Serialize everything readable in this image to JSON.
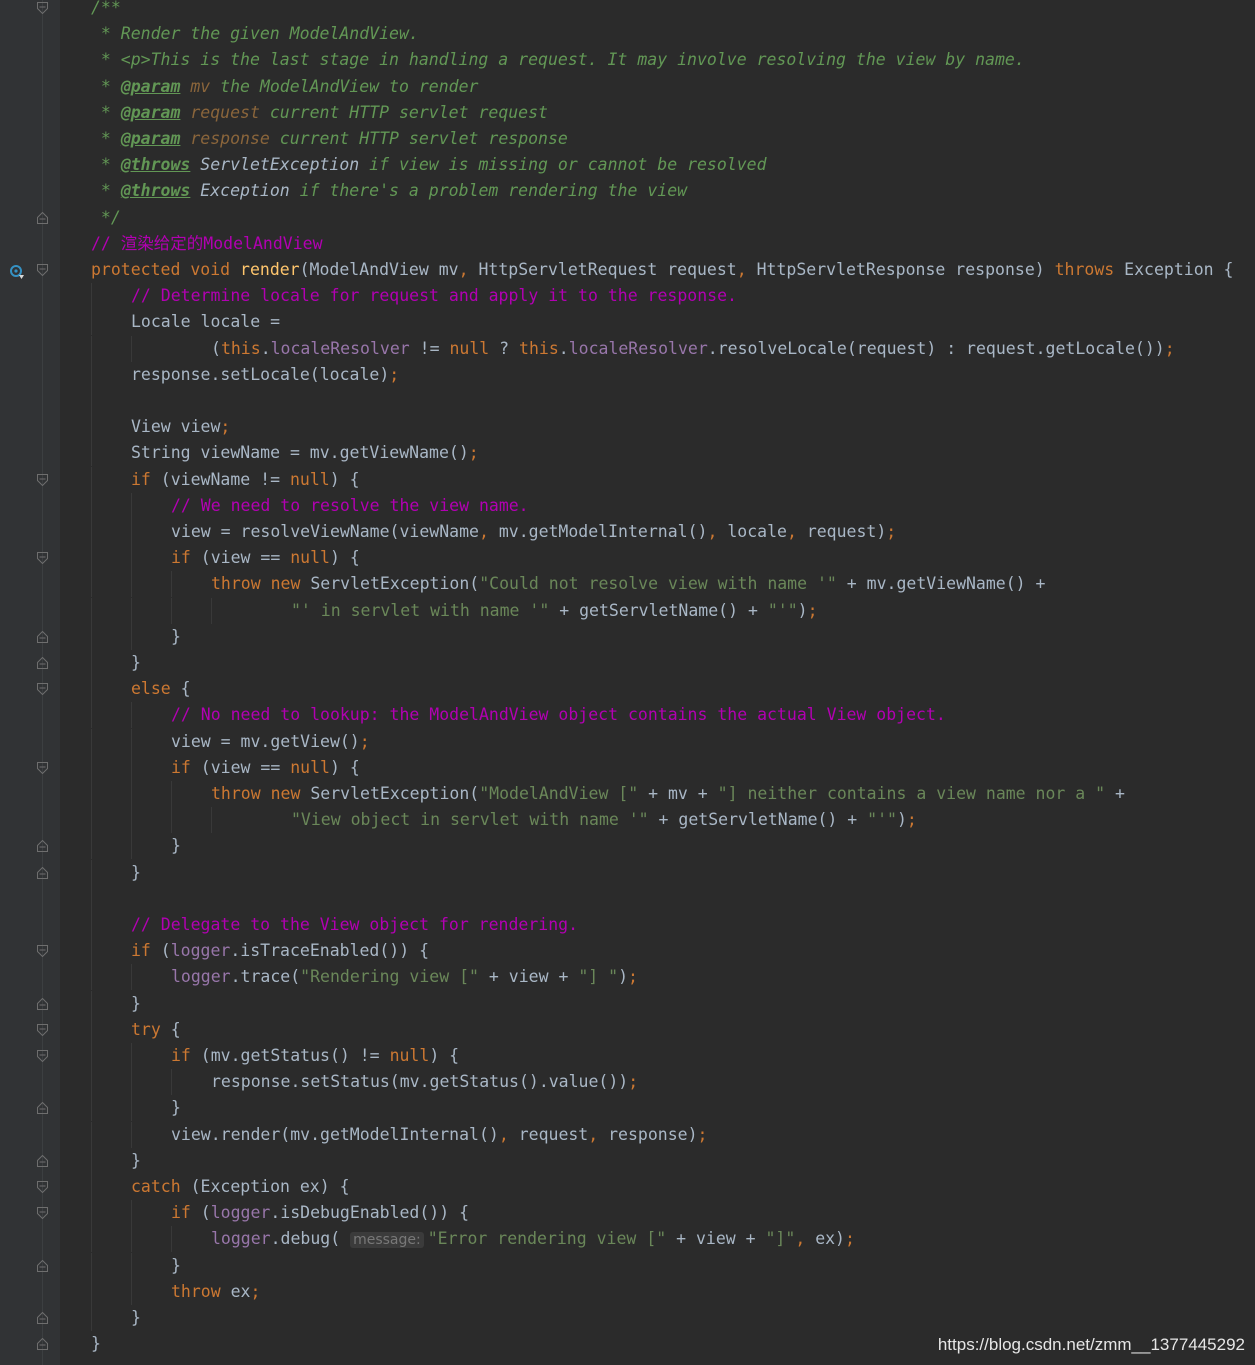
{
  "editor": {
    "language": "java",
    "theme": "Darcula",
    "colors": {
      "background": "#2b2b2b",
      "gutter": "#313335",
      "keyword": "#cc7832",
      "string": "#6a8759",
      "comment": "#b200b2",
      "javadoc": "#629755",
      "method_decl": "#ffc66d",
      "field": "#9876aa",
      "text": "#a9b7c6"
    },
    "gutter_icons": {
      "override": "implementing-method-icon",
      "fold": "fold-marker-icon"
    },
    "lines": [
      {
        "indent": 0,
        "fold": "open",
        "tokens": [
          {
            "c": "doc",
            "t": "/**"
          }
        ]
      },
      {
        "indent": 0,
        "tokens": [
          {
            "c": "doc",
            "t": " * Render the given ModelAndView."
          }
        ]
      },
      {
        "indent": 0,
        "tokens": [
          {
            "c": "doc",
            "t": " * <p>This is the last stage in handling a request. It may involve resolving the view by name."
          }
        ]
      },
      {
        "indent": 0,
        "tokens": [
          {
            "c": "doc",
            "t": " * "
          },
          {
            "c": "tag",
            "t": "@param"
          },
          {
            "c": "doc",
            "t": " "
          },
          {
            "c": "dparam",
            "t": "mv"
          },
          {
            "c": "doc",
            "t": " the ModelAndView to render"
          }
        ]
      },
      {
        "indent": 0,
        "tokens": [
          {
            "c": "doc",
            "t": " * "
          },
          {
            "c": "tag",
            "t": "@param"
          },
          {
            "c": "doc",
            "t": " "
          },
          {
            "c": "dparam",
            "t": "request"
          },
          {
            "c": "doc",
            "t": " current HTTP servlet request"
          }
        ]
      },
      {
        "indent": 0,
        "tokens": [
          {
            "c": "doc",
            "t": " * "
          },
          {
            "c": "tag",
            "t": "@param"
          },
          {
            "c": "doc",
            "t": " "
          },
          {
            "c": "dparam",
            "t": "response"
          },
          {
            "c": "doc",
            "t": " current HTTP servlet response"
          }
        ]
      },
      {
        "indent": 0,
        "tokens": [
          {
            "c": "doc",
            "t": " * "
          },
          {
            "c": "tag",
            "t": "@throws"
          },
          {
            "c": "doc",
            "t": " "
          },
          {
            "c": "dref",
            "t": "ServletException"
          },
          {
            "c": "doc",
            "t": " if view is missing or cannot be resolved"
          }
        ]
      },
      {
        "indent": 0,
        "tokens": [
          {
            "c": "doc",
            "t": " * "
          },
          {
            "c": "tag",
            "t": "@throws"
          },
          {
            "c": "doc",
            "t": " "
          },
          {
            "c": "dref",
            "t": "Exception"
          },
          {
            "c": "doc",
            "t": " if there's a problem rendering the view"
          }
        ]
      },
      {
        "indent": 0,
        "fold": "close",
        "tokens": [
          {
            "c": "doc",
            "t": " */"
          }
        ]
      },
      {
        "indent": 0,
        "tokens": [
          {
            "c": "cmt",
            "t": "// 渲染给定的ModelAndView"
          }
        ]
      },
      {
        "indent": 0,
        "fold": "open",
        "override": true,
        "tokens": [
          {
            "c": "kw",
            "t": "protected void "
          },
          {
            "c": "fn",
            "t": "render"
          },
          {
            "c": "txt",
            "t": "(ModelAndView mv"
          },
          {
            "c": "semi",
            "t": ", "
          },
          {
            "c": "txt",
            "t": "HttpServletRequest request"
          },
          {
            "c": "semi",
            "t": ", "
          },
          {
            "c": "txt",
            "t": "HttpServletResponse response) "
          },
          {
            "c": "kw",
            "t": "throws "
          },
          {
            "c": "txt",
            "t": "Exception {"
          }
        ]
      },
      {
        "indent": 1,
        "tokens": [
          {
            "c": "cmt",
            "t": "// Determine locale for request and apply it to the response."
          }
        ]
      },
      {
        "indent": 1,
        "tokens": [
          {
            "c": "txt",
            "t": "Locale locale ="
          }
        ]
      },
      {
        "indent": 3,
        "guides": 2,
        "tokens": [
          {
            "c": "txt",
            "t": "("
          },
          {
            "c": "kw",
            "t": "this"
          },
          {
            "c": "txt",
            "t": "."
          },
          {
            "c": "fld",
            "t": "localeResolver"
          },
          {
            "c": "txt",
            "t": " != "
          },
          {
            "c": "kw",
            "t": "null"
          },
          {
            "c": "txt",
            "t": " ? "
          },
          {
            "c": "kw",
            "t": "this"
          },
          {
            "c": "txt",
            "t": "."
          },
          {
            "c": "fld",
            "t": "localeResolver"
          },
          {
            "c": "txt",
            "t": ".resolveLocale(request) : request.getLocale())"
          },
          {
            "c": "semi",
            "t": ";"
          }
        ]
      },
      {
        "indent": 1,
        "tokens": [
          {
            "c": "txt",
            "t": "response.setLocale(locale)"
          },
          {
            "c": "semi",
            "t": ";"
          }
        ]
      },
      {
        "indent": 1,
        "tokens": []
      },
      {
        "indent": 1,
        "tokens": [
          {
            "c": "txt",
            "t": "View view"
          },
          {
            "c": "semi",
            "t": ";"
          }
        ]
      },
      {
        "indent": 1,
        "tokens": [
          {
            "c": "txt",
            "t": "String viewName = mv.getViewName()"
          },
          {
            "c": "semi",
            "t": ";"
          }
        ]
      },
      {
        "indent": 1,
        "fold": "open",
        "tokens": [
          {
            "c": "kw",
            "t": "if"
          },
          {
            "c": "txt",
            "t": " (viewName != "
          },
          {
            "c": "kw",
            "t": "null"
          },
          {
            "c": "txt",
            "t": ") {"
          }
        ]
      },
      {
        "indent": 2,
        "tokens": [
          {
            "c": "cmt",
            "t": "// We need to resolve the view name."
          }
        ]
      },
      {
        "indent": 2,
        "tokens": [
          {
            "c": "txt",
            "t": "view = resolveViewName(viewName"
          },
          {
            "c": "semi",
            "t": ", "
          },
          {
            "c": "txt",
            "t": "mv.getModelInternal()"
          },
          {
            "c": "semi",
            "t": ", "
          },
          {
            "c": "txt",
            "t": "locale"
          },
          {
            "c": "semi",
            "t": ", "
          },
          {
            "c": "txt",
            "t": "request)"
          },
          {
            "c": "semi",
            "t": ";"
          }
        ]
      },
      {
        "indent": 2,
        "fold": "open",
        "tokens": [
          {
            "c": "kw",
            "t": "if"
          },
          {
            "c": "txt",
            "t": " (view == "
          },
          {
            "c": "kw",
            "t": "null"
          },
          {
            "c": "txt",
            "t": ") {"
          }
        ]
      },
      {
        "indent": 3,
        "tokens": [
          {
            "c": "kw",
            "t": "throw new "
          },
          {
            "c": "txt",
            "t": "ServletException("
          },
          {
            "c": "str",
            "t": "\"Could not resolve view with name '\""
          },
          {
            "c": "txt",
            "t": " + mv.getViewName() +"
          }
        ]
      },
      {
        "indent": 5,
        "guides": 4,
        "tokens": [
          {
            "c": "str",
            "t": "\"' in servlet with name '\""
          },
          {
            "c": "txt",
            "t": " + getServletName() + "
          },
          {
            "c": "str",
            "t": "\"'\""
          },
          {
            "c": "txt",
            "t": ")"
          },
          {
            "c": "semi",
            "t": ";"
          }
        ]
      },
      {
        "indent": 2,
        "fold": "close",
        "tokens": [
          {
            "c": "txt",
            "t": "}"
          }
        ]
      },
      {
        "indent": 1,
        "fold": "close",
        "tokens": [
          {
            "c": "txt",
            "t": "}"
          }
        ]
      },
      {
        "indent": 1,
        "fold": "open",
        "tokens": [
          {
            "c": "kw",
            "t": "else"
          },
          {
            "c": "txt",
            "t": " {"
          }
        ]
      },
      {
        "indent": 2,
        "tokens": [
          {
            "c": "cmt",
            "t": "// No need to lookup: the ModelAndView object contains the actual View object."
          }
        ]
      },
      {
        "indent": 2,
        "tokens": [
          {
            "c": "txt",
            "t": "view = mv.getView()"
          },
          {
            "c": "semi",
            "t": ";"
          }
        ]
      },
      {
        "indent": 2,
        "fold": "open",
        "tokens": [
          {
            "c": "kw",
            "t": "if"
          },
          {
            "c": "txt",
            "t": " (view == "
          },
          {
            "c": "kw",
            "t": "null"
          },
          {
            "c": "txt",
            "t": ") {"
          }
        ]
      },
      {
        "indent": 3,
        "tokens": [
          {
            "c": "kw",
            "t": "throw new "
          },
          {
            "c": "txt",
            "t": "ServletException("
          },
          {
            "c": "str",
            "t": "\"ModelAndView [\""
          },
          {
            "c": "txt",
            "t": " + mv + "
          },
          {
            "c": "str",
            "t": "\"] neither contains a view name nor a \""
          },
          {
            "c": "txt",
            "t": " +"
          }
        ]
      },
      {
        "indent": 5,
        "guides": 4,
        "tokens": [
          {
            "c": "str",
            "t": "\"View object in servlet with name '\""
          },
          {
            "c": "txt",
            "t": " + getServletName() + "
          },
          {
            "c": "str",
            "t": "\"'\""
          },
          {
            "c": "txt",
            "t": ")"
          },
          {
            "c": "semi",
            "t": ";"
          }
        ]
      },
      {
        "indent": 2,
        "fold": "close",
        "tokens": [
          {
            "c": "txt",
            "t": "}"
          }
        ]
      },
      {
        "indent": 1,
        "fold": "close",
        "tokens": [
          {
            "c": "txt",
            "t": "}"
          }
        ]
      },
      {
        "indent": 1,
        "tokens": []
      },
      {
        "indent": 1,
        "tokens": [
          {
            "c": "cmt",
            "t": "// Delegate to the View object for rendering."
          }
        ]
      },
      {
        "indent": 1,
        "fold": "open",
        "tokens": [
          {
            "c": "kw",
            "t": "if"
          },
          {
            "c": "txt",
            "t": " ("
          },
          {
            "c": "fld",
            "t": "logger"
          },
          {
            "c": "txt",
            "t": ".isTraceEnabled()) {"
          }
        ]
      },
      {
        "indent": 2,
        "tokens": [
          {
            "c": "fld",
            "t": "logger"
          },
          {
            "c": "txt",
            "t": ".trace("
          },
          {
            "c": "str",
            "t": "\"Rendering view [\""
          },
          {
            "c": "txt",
            "t": " + view + "
          },
          {
            "c": "str",
            "t": "\"] \""
          },
          {
            "c": "txt",
            "t": ")"
          },
          {
            "c": "semi",
            "t": ";"
          }
        ]
      },
      {
        "indent": 1,
        "fold": "close",
        "tokens": [
          {
            "c": "txt",
            "t": "}"
          }
        ]
      },
      {
        "indent": 1,
        "fold": "open",
        "tokens": [
          {
            "c": "kw",
            "t": "try"
          },
          {
            "c": "txt",
            "t": " {"
          }
        ]
      },
      {
        "indent": 2,
        "fold": "open",
        "tokens": [
          {
            "c": "kw",
            "t": "if"
          },
          {
            "c": "txt",
            "t": " (mv.getStatus() != "
          },
          {
            "c": "kw",
            "t": "null"
          },
          {
            "c": "txt",
            "t": ") {"
          }
        ]
      },
      {
        "indent": 3,
        "tokens": [
          {
            "c": "txt",
            "t": "response.setStatus(mv.getStatus().value())"
          },
          {
            "c": "semi",
            "t": ";"
          }
        ]
      },
      {
        "indent": 2,
        "fold": "close",
        "tokens": [
          {
            "c": "txt",
            "t": "}"
          }
        ]
      },
      {
        "indent": 2,
        "tokens": [
          {
            "c": "txt",
            "t": "view.render(mv.getModelInternal()"
          },
          {
            "c": "semi",
            "t": ", "
          },
          {
            "c": "txt",
            "t": "request"
          },
          {
            "c": "semi",
            "t": ", "
          },
          {
            "c": "txt",
            "t": "response)"
          },
          {
            "c": "semi",
            "t": ";"
          }
        ]
      },
      {
        "indent": 1,
        "fold": "close",
        "tokens": [
          {
            "c": "txt",
            "t": "}"
          }
        ]
      },
      {
        "indent": 1,
        "fold": "open",
        "tokens": [
          {
            "c": "kw",
            "t": "catch"
          },
          {
            "c": "txt",
            "t": " (Exception ex) {"
          }
        ]
      },
      {
        "indent": 2,
        "fold": "open",
        "tokens": [
          {
            "c": "kw",
            "t": "if"
          },
          {
            "c": "txt",
            "t": " ("
          },
          {
            "c": "fld",
            "t": "logger"
          },
          {
            "c": "txt",
            "t": ".isDebugEnabled()) {"
          }
        ]
      },
      {
        "indent": 3,
        "tokens": [
          {
            "c": "fld",
            "t": "logger"
          },
          {
            "c": "txt",
            "t": ".debug( "
          },
          {
            "c": "hint",
            "t": "message:"
          },
          {
            "c": "str",
            "t": "\"Error rendering view [\""
          },
          {
            "c": "txt",
            "t": " + view + "
          },
          {
            "c": "str",
            "t": "\"]\""
          },
          {
            "c": "semi",
            "t": ", "
          },
          {
            "c": "txt",
            "t": "ex)"
          },
          {
            "c": "semi",
            "t": ";"
          }
        ]
      },
      {
        "indent": 2,
        "fold": "close",
        "tokens": [
          {
            "c": "txt",
            "t": "}"
          }
        ]
      },
      {
        "indent": 2,
        "tokens": [
          {
            "c": "kw",
            "t": "throw"
          },
          {
            "c": "txt",
            "t": " ex"
          },
          {
            "c": "semi",
            "t": ";"
          }
        ]
      },
      {
        "indent": 1,
        "fold": "close",
        "tokens": [
          {
            "c": "txt",
            "t": "}"
          }
        ]
      },
      {
        "indent": 0,
        "fold": "close",
        "tokens": [
          {
            "c": "txt",
            "t": "}"
          }
        ]
      }
    ]
  },
  "watermark": "https://blog.csdn.net/zmm__1377445292"
}
